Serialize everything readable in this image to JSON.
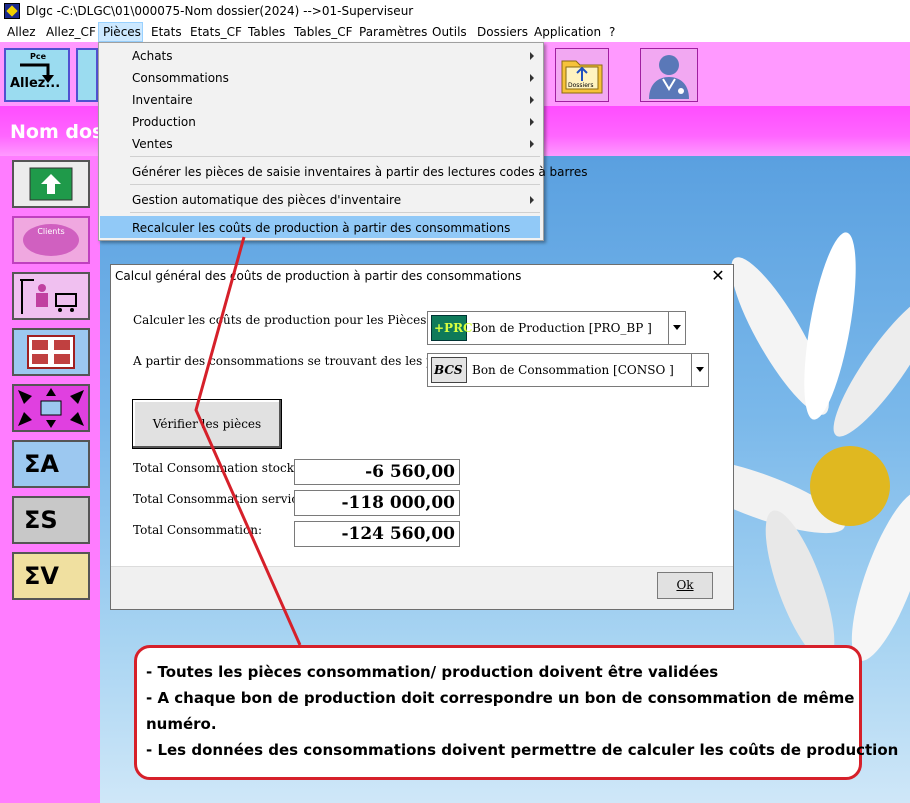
{
  "window": {
    "title": "Dlgc -C:\\DLGC\\01\\000075-Nom dossier(2024) -->01-Superviseur"
  },
  "menubar": {
    "items": [
      {
        "label": "Allez"
      },
      {
        "label": "Allez_CF"
      },
      {
        "label": "Pièces"
      },
      {
        "label": "Etats"
      },
      {
        "label": "Etats_CF"
      },
      {
        "label": "Tables"
      },
      {
        "label": "Tables_CF"
      },
      {
        "label": "Paramètres"
      },
      {
        "label": "Outils"
      },
      {
        "label": "Dossiers"
      },
      {
        "label": "Application"
      },
      {
        "label": "?"
      }
    ]
  },
  "toolbar": {
    "allez_label": "Allez...",
    "pce_label": "Pce",
    "dossiers_label": "Dossiers"
  },
  "header": {
    "title": "Nom dos"
  },
  "sidebar": {
    "clients_label": "Clients",
    "sum_a": "ΣA",
    "sum_s": "ΣS",
    "sum_v": "ΣV"
  },
  "dropdown": {
    "items": [
      {
        "label": "Achats"
      },
      {
        "label": "Consommations"
      },
      {
        "label": "Inventaire"
      },
      {
        "label": "Production"
      },
      {
        "label": "Ventes"
      },
      {
        "label": "Générer les pièces de saisie inventaires à partir des lectures codes à barres"
      },
      {
        "label": "Gestion automatique des pièces d'inventaire"
      },
      {
        "label": "Recalculer les coûts de production à partir des consommations"
      }
    ]
  },
  "dialog": {
    "title": "Calcul général des coûts de production à partir des consommations",
    "close": "✕",
    "label_pieces": "Calculer les coûts de production pour les Pièces:",
    "label_conso": "A partir des consommations se trouvant des les pièces:",
    "combo_prod": {
      "icon_text": "+PRC",
      "value": "Bon de Production [PRO_BP     ]"
    },
    "combo_conso": {
      "icon_text": "BCS",
      "value": "Bon de Consommation [CONSO     ]"
    },
    "verify_label": "Vérifier les pièces",
    "totals": [
      {
        "label": "Total Consommation stocks:",
        "value": "-6 560,00"
      },
      {
        "label": "Total Consommation services:",
        "value": "-118 000,00"
      },
      {
        "label": "Total Consommation:",
        "value": "-124 560,00"
      }
    ],
    "ok_label": "Ok"
  },
  "note": {
    "lines": [
      "- Toutes les pièces consommation/ production  doivent être validées",
      "- A chaque bon de production doit correspondre un bon de consommation de même",
      "numéro.",
      "- Les données  des consommations doivent permettre de calculer les coûts de production"
    ]
  },
  "colors": {
    "accent_pink": "#ff66ff",
    "menu_highlight": "#91c9f7",
    "note_border": "#d6202a"
  }
}
